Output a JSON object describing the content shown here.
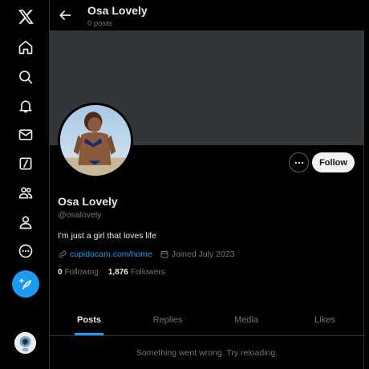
{
  "nav": {
    "items": [
      {
        "name": "x-logo"
      },
      {
        "name": "home"
      },
      {
        "name": "explore"
      },
      {
        "name": "notifications"
      },
      {
        "name": "messages"
      },
      {
        "name": "grok"
      },
      {
        "name": "communities"
      },
      {
        "name": "profile"
      },
      {
        "name": "more"
      }
    ],
    "post_button": "post",
    "accent": "#1d9bf0"
  },
  "header": {
    "title": "Osa Lovely",
    "post_count": "0 posts"
  },
  "profile": {
    "display_name": "Osa Lovely",
    "handle": "@osalovely",
    "bio": "I'm just a girl that loves life",
    "link": "cupidocam.com/home",
    "joined": "Joined July 2023",
    "following_count": "0",
    "following_label": "Following",
    "followers_count": "1,876",
    "followers_label": "Followers",
    "follow_label": "Follow"
  },
  "tabs": [
    {
      "label": "Posts",
      "active": true
    },
    {
      "label": "Replies",
      "active": false
    },
    {
      "label": "Media",
      "active": false
    },
    {
      "label": "Likes",
      "active": false
    }
  ],
  "feed": {
    "error_message": "Something went wrong. Try reloading."
  }
}
